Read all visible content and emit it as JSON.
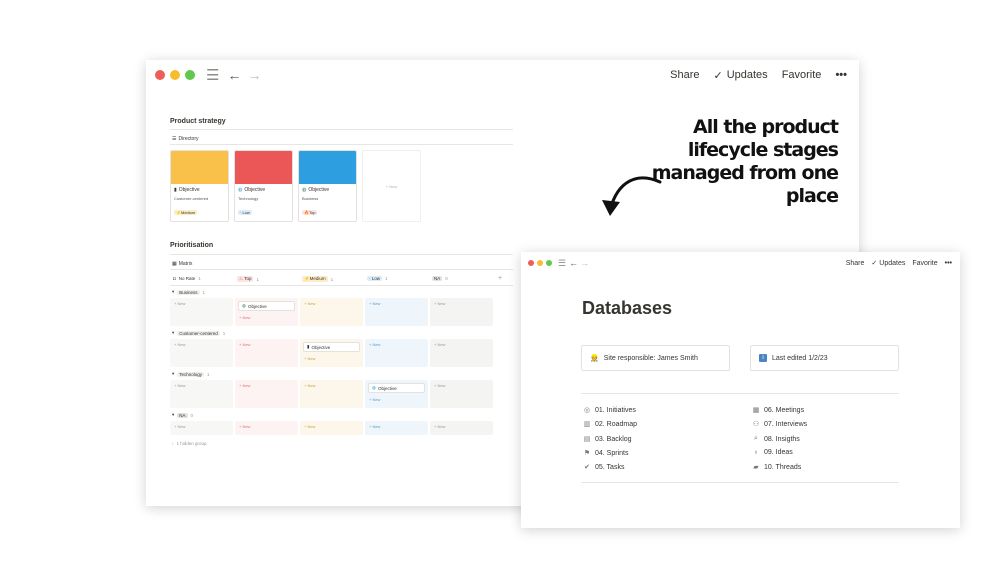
{
  "toolbar": {
    "share": "Share",
    "updates": "Updates",
    "favorite": "Favorite",
    "more": "•••"
  },
  "headline": "All the product lifecycle stages managed from one place",
  "strategy": {
    "title": "Product strategy",
    "view": "Directory",
    "cards": [
      {
        "title": "Objective",
        "tag": "Customer-centered",
        "priority": "Medium",
        "color": "#f9c14a",
        "icon": "phone-icon"
      },
      {
        "title": "Objective",
        "tag": "Technology",
        "priority": "Low",
        "color": "#eb5757",
        "icon": "globe-icon"
      },
      {
        "title": "Objective",
        "tag": "Business",
        "priority": "Top",
        "color": "#2d9ee0",
        "icon": "earth-icon"
      }
    ],
    "new_label": "+ New"
  },
  "prio": {
    "title": "Prioritisation",
    "view": "Matrix",
    "columns": [
      {
        "label": "No Rate",
        "count": "1"
      },
      {
        "label": "Top",
        "count": "1"
      },
      {
        "label": "Medium",
        "count": "1"
      },
      {
        "label": "Low",
        "count": "1"
      },
      {
        "label": "NA",
        "count": "0"
      }
    ],
    "groups": [
      {
        "label": "Business",
        "count": "1"
      },
      {
        "label": "Customer-centered",
        "count": "1"
      },
      {
        "label": "Technology",
        "count": "1"
      },
      {
        "label": "NA",
        "count": "0"
      }
    ],
    "objective": "Objective",
    "new_label": "+ New",
    "hidden": "1 hidden group"
  },
  "db": {
    "title": "Databases",
    "callout1": "Site responsible: James Smith",
    "callout2": "Last edited 1/2/23",
    "left": [
      "01. Initiatives",
      "02. Roadmap",
      "03. Backlog",
      "04. Sprints",
      "05. Tasks"
    ],
    "right": [
      "06. Meetings",
      "07. Interviews",
      "08. Insigths",
      "09. Ideas",
      "10. Threads"
    ]
  },
  "colors": {
    "top": "#fbe4e4",
    "medium": "#fdecc8",
    "low": "#dcecf9",
    "na": "#e3e2e0"
  }
}
